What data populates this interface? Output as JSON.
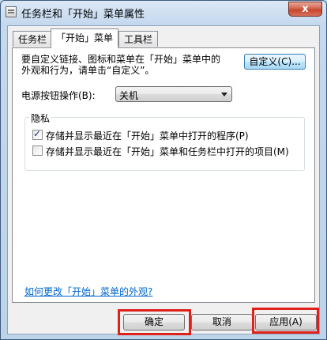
{
  "window": {
    "title": "任务栏和「开始」菜单属性",
    "close_label": "x"
  },
  "tabs": [
    {
      "label": "任务栏",
      "active": false
    },
    {
      "label": "「开始」菜单",
      "active": true
    },
    {
      "label": "工具栏",
      "active": false
    }
  ],
  "panel": {
    "description_line1": "要自定义链接、图标和菜单在「开始」菜单中的",
    "description_line2": "外观和行为，请单击“自定义”。",
    "customize_button": "自定义(C)...",
    "power_label": "电源按钮操作(B):",
    "power_value": "关机",
    "privacy": {
      "title": "隐私",
      "options": [
        {
          "label": "存储并显示最近在「开始」菜单中打开的程序(P)",
          "checked": true
        },
        {
          "label": "存储并显示最近在「开始」菜单和任务栏中打开的项目(M)",
          "checked": false
        }
      ]
    },
    "help_link": "如何更改「开始」菜单的外观?"
  },
  "buttons": {
    "ok": "确定",
    "cancel": "取消",
    "apply": "应用(A)"
  },
  "colors": {
    "highlight": "#e0201b",
    "link": "#0066cc"
  }
}
